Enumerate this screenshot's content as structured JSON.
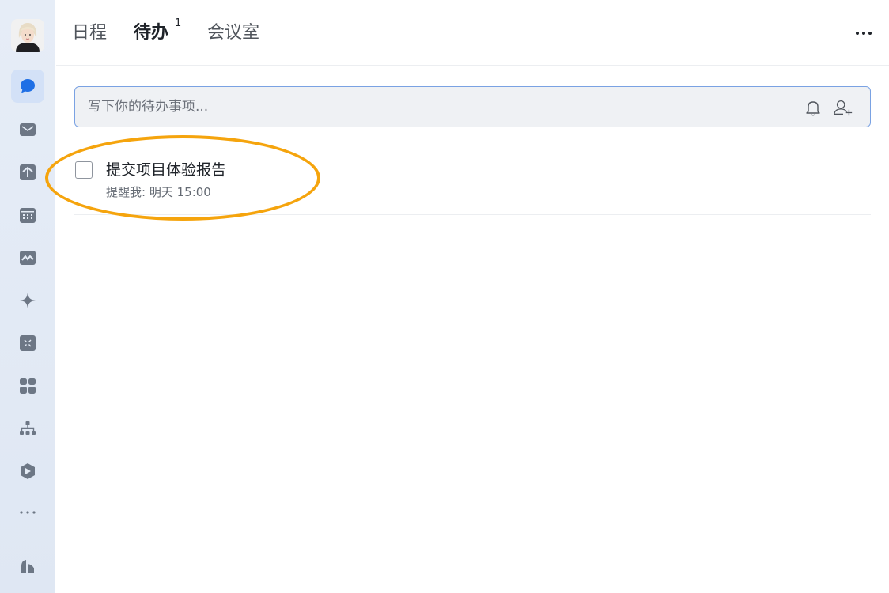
{
  "tabs": [
    {
      "label": "日程"
    },
    {
      "label": "待办",
      "badge": "1"
    },
    {
      "label": "会议室"
    }
  ],
  "todo_input": {
    "placeholder": "写下你的待办事项..."
  },
  "todos": [
    {
      "title": "提交项目体验报告",
      "reminder_label": "提醒我:",
      "reminder_time": "明天 15:00",
      "checked": false
    }
  ],
  "sidebar": {
    "icons": [
      "chat-icon",
      "mail-icon",
      "docs-icon",
      "calendar-icon",
      "meeting-icon",
      "ai-star-icon",
      "workplace-icon",
      "apps-icon",
      "org-icon",
      "base-icon",
      "more-icon",
      "stats-icon"
    ],
    "active": "chat-icon"
  },
  "colors": {
    "accent": "#1f6fe5",
    "highlight": "#f5a40d",
    "sidebar_icon": "#6d7785"
  }
}
